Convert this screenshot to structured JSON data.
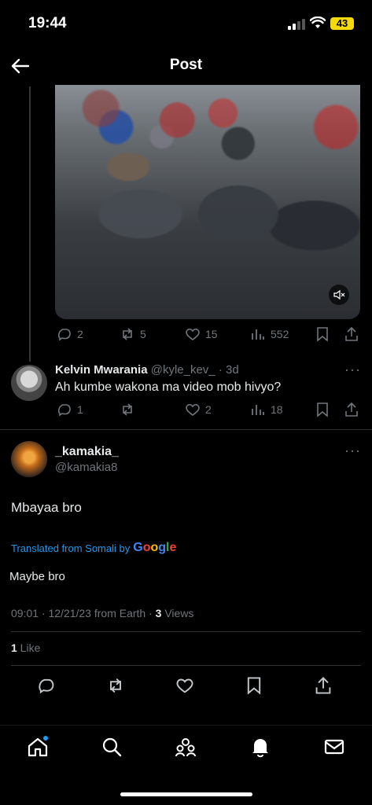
{
  "status_bar": {
    "time": "19:44",
    "battery": "43"
  },
  "header": {
    "title": "Post"
  },
  "quoted_post_stats": {
    "replies": "2",
    "reposts": "5",
    "likes": "15",
    "views": "552"
  },
  "reply": {
    "name": "Kelvin Mwarania",
    "handle": "@kyle_kev_",
    "age": "· 3d",
    "text": "Ah kumbe wakona ma video mob hivyo?",
    "stats": {
      "replies": "1",
      "reposts": "",
      "likes": "2",
      "views": "18"
    }
  },
  "main_post": {
    "name": "_kamakia_",
    "handle": "@kamakia8",
    "text": "Mbayaa bro",
    "translated_label": "Translated from Somali by",
    "translator": "Google",
    "translation": "Maybe bro",
    "meta_time": "09:01 · 12/21/23 from Earth · ",
    "views_count": "3",
    "views_label": " Views",
    "likes_count": "1",
    "likes_label": " Like"
  },
  "colors": {
    "accent": "#1d9bf0",
    "muted": "#71767b",
    "text": "#e7e9ea",
    "background": "#000000"
  }
}
